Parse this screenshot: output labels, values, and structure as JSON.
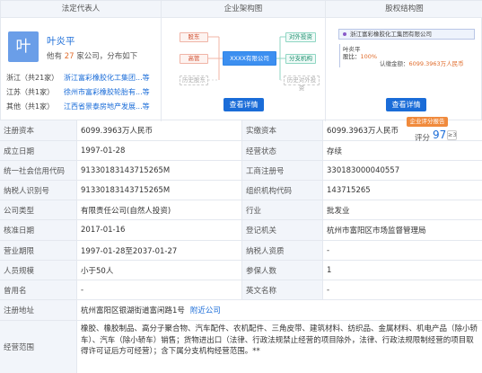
{
  "panels": {
    "legal_rep": {
      "title": "法定代表人",
      "avatar_char": "叶",
      "name": "叶炎平",
      "sub_prefix": "他有",
      "sub_count": "27",
      "sub_suffix": "家公司，分布如下",
      "regions": [
        {
          "name": "浙江",
          "count": "（共21家）",
          "company": "浙江富彩橡胶化工集团...等"
        },
        {
          "name": "江苏",
          "count": "（共1家）",
          "company": "徐州市富彩橡胶轮胎有...等"
        },
        {
          "name": "其他",
          "count": "（共1家）",
          "company": "江西省景泰房地产发展...等"
        }
      ]
    },
    "structure": {
      "title": "企业架构图",
      "shareholder_label": "股东",
      "executive_label": "高管",
      "history_label": "历史股东",
      "center_label": "XXXX有限公司",
      "investment_label": "对外投资",
      "branch_label": "分支机构",
      "history_investment_label": "历史对外投资",
      "button": "查看详情"
    },
    "equity": {
      "title": "股权结构图",
      "company": "浙江富彩橡胶化工集团有限公司",
      "person": "叶炎平",
      "ratio_label": "股比：",
      "ratio": "100%",
      "amount_label": "认缴金额：",
      "amount": "6099.3963万人民币",
      "button": "查看详情"
    }
  },
  "score": {
    "badge": "企业评分报告",
    "label": "评分",
    "value": "97",
    "chip": "≥3"
  },
  "table": {
    "rows": [
      {
        "l1": "注册资本",
        "v1": "6099.3963万人民币",
        "l2": "实缴资本",
        "v2": "6099.3963万人民币"
      },
      {
        "l1": "成立日期",
        "v1": "1997-01-28",
        "l2": "经营状态",
        "v2": "存续"
      },
      {
        "l1": "统一社会信用代码",
        "v1": "91330183143715265M",
        "l2": "工商注册号",
        "v2": "330183000040557"
      },
      {
        "l1": "纳税人识别号",
        "v1": "91330183143715265M",
        "l2": "组织机构代码",
        "v2": "143715265"
      },
      {
        "l1": "公司类型",
        "v1": "有限责任公司(自然人投资)",
        "l2": "行业",
        "v2": "批发业"
      },
      {
        "l1": "核准日期",
        "v1": "2017-01-16",
        "l2": "登记机关",
        "v2": "杭州市富阳区市场监督管理局"
      },
      {
        "l1": "营业期限",
        "v1": "1997-01-28至2037-01-27",
        "l2": "纳税人资质",
        "v2": "-"
      },
      {
        "l1": "人员规模",
        "v1": "小于50人",
        "l2": "参保人数",
        "v2": "1"
      },
      {
        "l1": "曾用名",
        "v1": "-",
        "l2": "英文名称",
        "v2": "-"
      }
    ],
    "address_label": "注册地址",
    "address": "杭州富阳区银湖街道富闲路1号",
    "address_link": "附近公司",
    "scope_label": "经营范围",
    "scope": "橡胶、橡胶制品、高分子聚合物、汽车配件、农机配件、三角皮带、建筑材料、纺织品、金属材料、机电产品（除小轿车）、汽车（除小轿车）销售；货物进出口（法律、行政法规禁止经营的项目除外，法律、行政法规限制经营的项目取得许可证后方可经营）；含下属分支机构经营范围。**"
  }
}
